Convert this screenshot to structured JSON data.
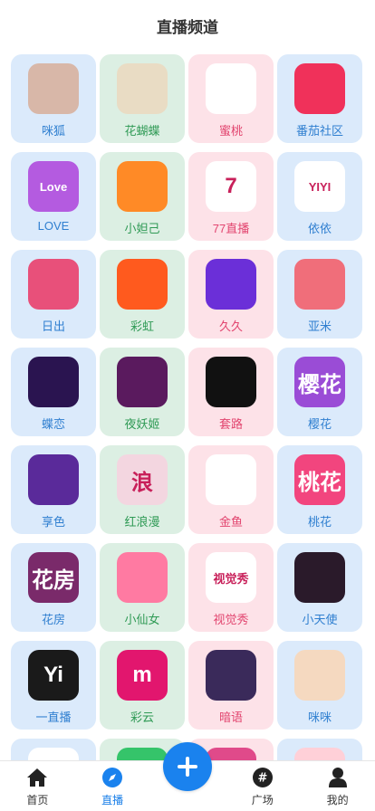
{
  "page_title": "直播频道",
  "channels": [
    {
      "label": "咪狐",
      "icon": "fox-girl-icon",
      "bg": "#d8b7a8"
    },
    {
      "label": "花蝴蝶",
      "icon": "butterfly-icon",
      "bg": "#e9dcc4"
    },
    {
      "label": "蜜桃",
      "icon": "peach-icon",
      "bg": "#ffffff"
    },
    {
      "label": "番茄社区",
      "icon": "tomato-icon",
      "bg": "#f0315a"
    },
    {
      "label": "LOVE",
      "icon": "love-icon",
      "bg": "#b45be0",
      "text": "Love"
    },
    {
      "label": "小妲己",
      "icon": "fairy-icon",
      "bg": "#ff8a26"
    },
    {
      "label": "77直播",
      "icon": "seven-icon",
      "bg": "#ffffff",
      "text": "7"
    },
    {
      "label": "依依",
      "icon": "yiyi-icon",
      "bg": "#ffffff",
      "text": "YIYI"
    },
    {
      "label": "日出",
      "icon": "heart-play-icon",
      "bg": "#e8507a"
    },
    {
      "label": "彩虹",
      "icon": "tv-play-icon",
      "bg": "#ff5a1e"
    },
    {
      "label": "久久",
      "icon": "dancer-icon",
      "bg": "#6b2fd8"
    },
    {
      "label": "亚米",
      "icon": "pole-dancer-icon",
      "bg": "#f06e7a"
    },
    {
      "label": "蝶恋",
      "icon": "butterfly-glow-icon",
      "bg": "#2a1450"
    },
    {
      "label": "夜妖姬",
      "icon": "lotus-icon",
      "bg": "#5a1a5e"
    },
    {
      "label": "套路",
      "icon": "ape-icon",
      "bg": "#111111"
    },
    {
      "label": "樱花",
      "icon": "sakura-icon",
      "bg": "#9a4cd6",
      "text": "樱花"
    },
    {
      "label": "享色",
      "icon": "play-wave-icon",
      "bg": "#5a2a9a"
    },
    {
      "label": "红浪漫",
      "icon": "lang-icon",
      "bg": "#f3d6e0",
      "text": "浪"
    },
    {
      "label": "金鱼",
      "icon": "goldfish-icon",
      "bg": "#ffffff"
    },
    {
      "label": "桃花",
      "icon": "taohua-icon",
      "bg": "#f2457e",
      "text": "桃花"
    },
    {
      "label": "花房",
      "icon": "huafang-icon",
      "bg": "#7a2a6a",
      "text": "花房"
    },
    {
      "label": "小仙女",
      "icon": "fairy-girl-icon",
      "bg": "#ff7aa2"
    },
    {
      "label": "视觉秀",
      "icon": "show-icon",
      "bg": "#ffffff",
      "text": "视觉秀"
    },
    {
      "label": "小天使",
      "icon": "angel-icon",
      "bg": "#2a1a2a"
    },
    {
      "label": "一直播",
      "icon": "yi-icon",
      "bg": "#1a1a1a",
      "text": "Yi"
    },
    {
      "label": "彩云",
      "icon": "cloud-m-icon",
      "bg": "#e2166e",
      "text": "m"
    },
    {
      "label": "暗语",
      "icon": "lock-dial-icon",
      "bg": "#3a2a5a"
    },
    {
      "label": "咪咪",
      "icon": "anime-girl-icon",
      "bg": "#f5d9c0"
    },
    {
      "label": "",
      "icon": "partial-app-icon",
      "bg": "#ffffff"
    },
    {
      "label": "",
      "icon": "partial-app-icon",
      "bg": "#35c46a"
    },
    {
      "label": "",
      "icon": "partial-app-icon",
      "bg": "#e04a8a"
    },
    {
      "label": "",
      "icon": "partial-app-icon",
      "bg": "#ffd0d8"
    }
  ],
  "tabbar": {
    "home": "首页",
    "live": "直播",
    "square": "广场",
    "mine": "我的"
  },
  "colors": {
    "accent": "#1a82ee",
    "tile_blue": "#dbeafb",
    "tile_green": "#dcefe3",
    "tile_pink": "#fde2e8"
  }
}
